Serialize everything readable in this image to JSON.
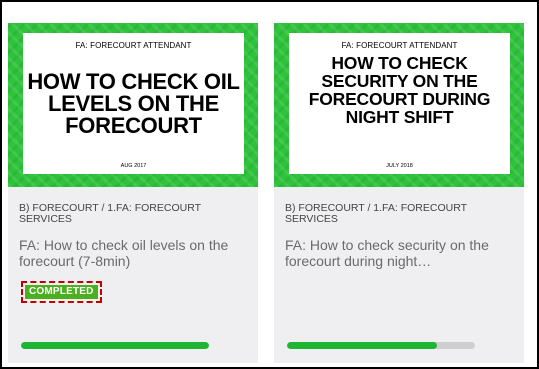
{
  "cards": [
    {
      "thumbnail": {
        "category": "FA: FORECOURT ATTENDANT",
        "headline": "HOW TO CHECK OIL LEVELS ON THE FORECOURT",
        "date": "AUG 2017"
      },
      "category": "B) FORECOURT / 1.FA: FORECOURT SERVICES",
      "title": "FA: How to check oil levels on the forecourt (7-8min)",
      "badge": "COMPLETED",
      "progress": 1.0
    },
    {
      "thumbnail": {
        "category": "FA: FORECOURT ATTENDANT",
        "headline": "HOW TO CHECK SECURITY ON THE FORECOURT DURING NIGHT SHIFT",
        "date": "JULY 2018"
      },
      "category": "B) FORECOURT / 1.FA: FORECOURT SERVICES",
      "title": "FA: How to check security on the forecourt during night…",
      "progress": 0.8
    }
  ],
  "colors": {
    "thumb_green": "#2ec33b",
    "badge_green": "#4bb01e",
    "progress_fill": "#1fb534",
    "progress_track": "#cfcfd2",
    "highlight": "#c00000"
  }
}
